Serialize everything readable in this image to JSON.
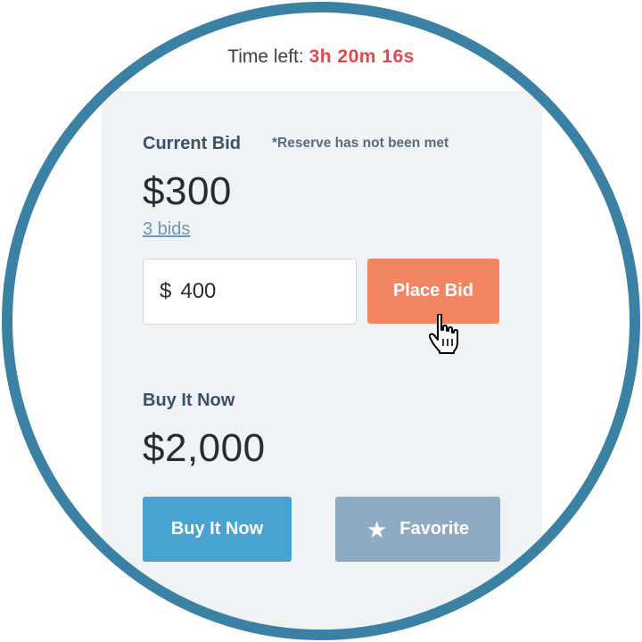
{
  "timer": {
    "label": "Time left:",
    "remaining": "3h 20m 16s"
  },
  "bid": {
    "label": "Current Bid",
    "reserve_note": "*Reserve has not been met",
    "amount": "$300",
    "bids_count": "3 bids",
    "input_currency": "$",
    "input_value": "400",
    "button_label": "Place Bid"
  },
  "buy_now": {
    "label": "Buy It Now",
    "price": "$2,000",
    "button_label": "Buy It Now"
  },
  "favorite": {
    "icon": "star-icon",
    "label": "Favorite"
  },
  "colors": {
    "frame": "#3b81a4",
    "time_remaining": "#e0494f",
    "place_bid": "#f38563",
    "buy_now": "#47a3d1",
    "favorite": "#8fabc3"
  }
}
